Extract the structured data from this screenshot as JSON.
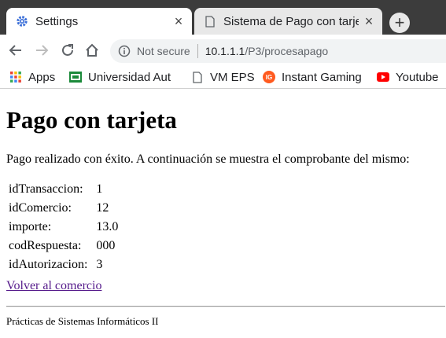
{
  "tabs": [
    {
      "title": "Settings",
      "icon": "gear-icon",
      "active": true
    },
    {
      "title": "Sistema de Pago con tarjeta",
      "icon": "document-icon",
      "active": false
    }
  ],
  "omnibox": {
    "security_label": "Not secure",
    "host": "10.1.1.1",
    "path": "/P3/procesapago"
  },
  "bookmarks": [
    {
      "label": "Apps",
      "icon": "apps-grid-icon"
    },
    {
      "label": "Universidad Aut",
      "icon": "ua-logo-icon"
    },
    {
      "label": "VM EPS",
      "icon": "document-icon"
    },
    {
      "label": "Instant Gaming",
      "icon": "instant-gaming-icon"
    },
    {
      "label": "Youtube",
      "icon": "youtube-icon"
    }
  ],
  "page": {
    "heading": "Pago con tarjeta",
    "message": "Pago realizado con éxito. A continuación se muestra el comprobante del mismo:",
    "receipt": [
      {
        "key": "idTransaccion:",
        "value": "1"
      },
      {
        "key": "idComercio:",
        "value": "12"
      },
      {
        "key": "importe:",
        "value": "13.0"
      },
      {
        "key": "codRespuesta:",
        "value": "000"
      },
      {
        "key": "idAutorizacion:",
        "value": "3"
      }
    ],
    "back_link": "Volver al comercio",
    "footer": "Prácticas de Sistemas Informáticos II"
  },
  "colors": {
    "tabstrip": "#3c3c3c",
    "link_visited": "#551a8b",
    "youtube_red": "#ff0000",
    "instant_gaming": "#ff5a1f",
    "settings_blue": "#3b6fd8"
  }
}
